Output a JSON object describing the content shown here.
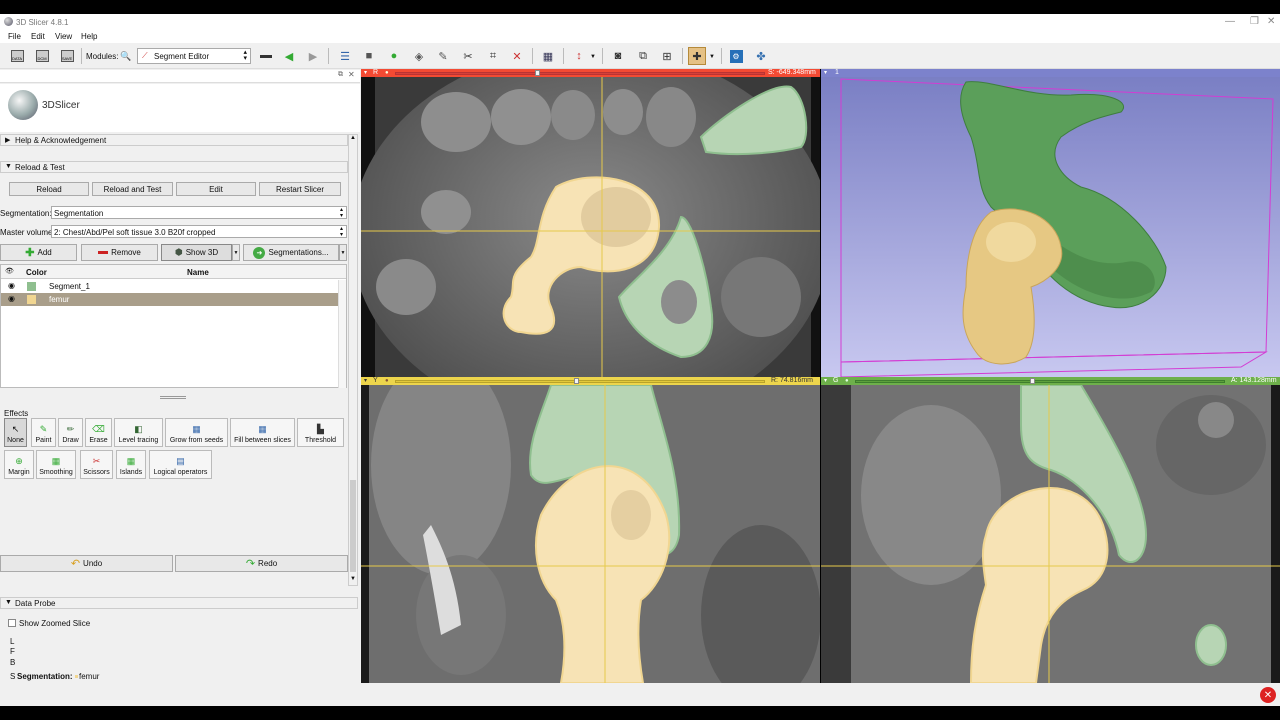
{
  "window": {
    "title": "3D Slicer 4.8.1"
  },
  "menu": [
    "File",
    "Edit",
    "View",
    "Help"
  ],
  "toolbar": {
    "data_label": "DATA",
    "dcm_label": "DCM",
    "save_label": "SAVE",
    "modules_label": "Modules:",
    "module_selected": "Segment Editor"
  },
  "logo": {
    "text": "3DSlicer"
  },
  "sections": {
    "help": "Help & Acknowledgement",
    "reload": "Reload & Test",
    "data_probe": "Data Probe"
  },
  "reload_buttons": [
    "Reload",
    "Reload and Test",
    "Edit",
    "Restart Slicer"
  ],
  "segmentation": {
    "label": "Segmentation:",
    "value": "Segmentation",
    "master_label": "Master volume:",
    "master_value": "2: Chest/Abd/Pel soft tissue  3.0  B20f cropped"
  },
  "seg_buttons": {
    "add": "Add",
    "remove": "Remove",
    "show3d": "Show 3D",
    "segmentations": "Segmentations..."
  },
  "table": {
    "headers": {
      "color": "Color",
      "name": "Name"
    },
    "rows": [
      {
        "name": "Segment_1",
        "color": "#8fbf8f",
        "selected": false
      },
      {
        "name": "femur",
        "color": "#f1d691",
        "selected": true
      }
    ]
  },
  "effects": {
    "label": "Effects",
    "row1": [
      "None",
      "Paint",
      "Draw",
      "Erase",
      "Level tracing",
      "Grow from seeds",
      "Fill between slices",
      "Threshold"
    ],
    "row2": [
      "Margin",
      "Smoothing",
      "Scissors",
      "Islands",
      "Logical operators"
    ]
  },
  "undo_label": "Undo",
  "redo_label": "Redo",
  "probe": {
    "show_zoomed": "Show Zoomed Slice",
    "lines": [
      "L",
      "F",
      "B"
    ],
    "seg_prefix": "S",
    "seg_label": "Segmentation:",
    "seg_value": "femur"
  },
  "views": {
    "red": {
      "letter": "R",
      "value": "S: -649.348mm",
      "color": "#f34a33"
    },
    "green": {
      "letter": "G",
      "value": "A: 143.128mm",
      "color": "#6eb04b"
    },
    "yellow": {
      "letter": "Y",
      "value": "R: 74.816mm",
      "color": "#edd54c"
    },
    "threed": {
      "letter": "1"
    }
  },
  "colors": {
    "segment_green": "#8fbf8f",
    "femur": "#f1d691",
    "three_d_bg_top": "#7a7fc4",
    "three_d_bg_bottom": "#c8c8f0"
  }
}
